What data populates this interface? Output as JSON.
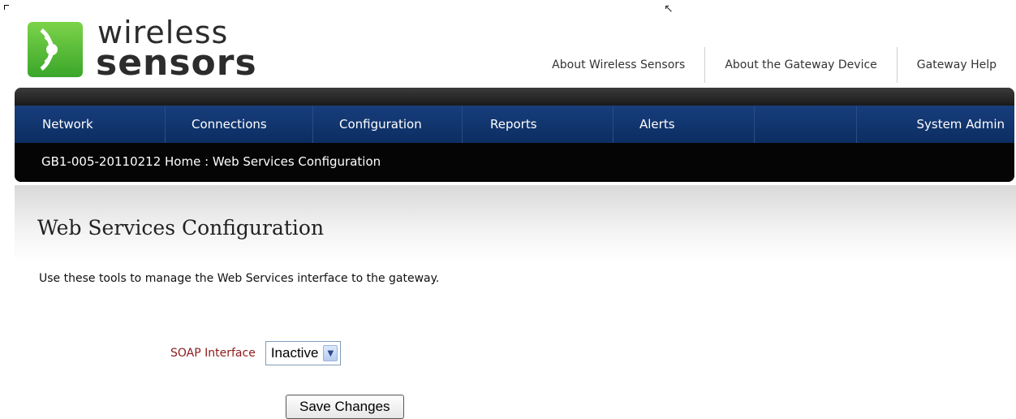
{
  "logo": {
    "line1": "wireless",
    "line2": "sensors"
  },
  "top_links": [
    "About Wireless Sensors",
    "About the Gateway Device",
    "Gateway Help"
  ],
  "nav": [
    "Network",
    "Connections",
    "Configuration",
    "Reports",
    "Alerts",
    "",
    "System Admin"
  ],
  "breadcrumb": "GB1-005-20110212 Home : Web Services Configuration",
  "page": {
    "title": "Web Services Configuration",
    "description": "Use these tools to manage the Web Services interface to the gateway."
  },
  "form": {
    "soap_label": "SOAP Interface",
    "soap_value": "Inactive",
    "save_label": "Save Changes"
  },
  "colors": {
    "nav_bg": "#173e7c",
    "label": "#8b1a1a",
    "logo_green": "#5cbf3a"
  }
}
